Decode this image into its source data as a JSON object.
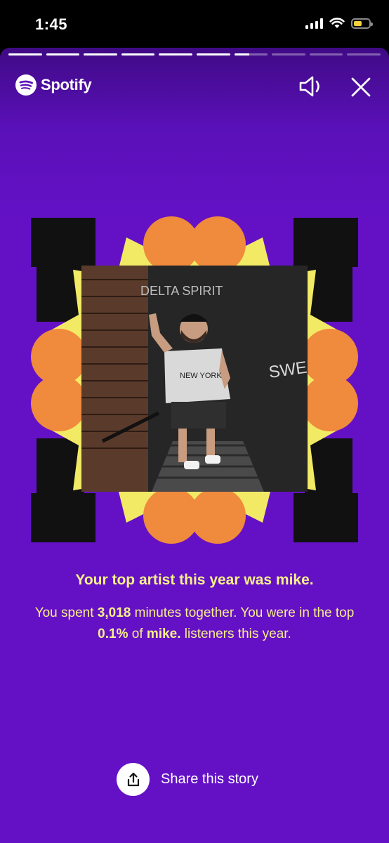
{
  "status_bar": {
    "time": "1:45",
    "battery_level": 0.55,
    "battery_color": "#f4d03f"
  },
  "story": {
    "progress": [
      1,
      1,
      1,
      1,
      1,
      1,
      0.45,
      0,
      0,
      0
    ],
    "brand": "Spotify",
    "brand_color": "#1ed760",
    "background_color": "#6411c6",
    "icons": {
      "sound": "speaker-icon",
      "close": "close-icon",
      "share": "share-icon"
    },
    "artwork": {
      "frame_colors": [
        "#111111",
        "#f2ea64",
        "#f08a3c"
      ],
      "photo_sign_text": "DELTA SPIRIT",
      "photo_wall_text": "SWELL",
      "shirt_text": "NEW YORK"
    },
    "headline": "Your top artist this year was mike.",
    "body": {
      "part1": "You spent ",
      "minutes": "3,018",
      "part2": " minutes together. You were in the top ",
      "percent": "0.1%",
      "part3": " of ",
      "artist": "mike.",
      "part4": " listeners this year."
    },
    "share_label": "Share this story"
  }
}
